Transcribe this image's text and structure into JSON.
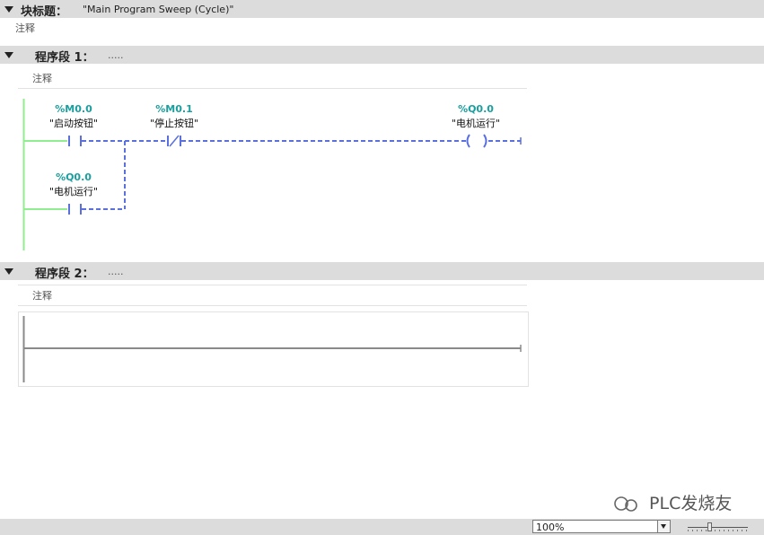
{
  "block": {
    "title_label": "块标题：",
    "title_value": "\"Main Program Sweep (Cycle)\"",
    "comment": "注释"
  },
  "networks": [
    {
      "label": "程序段 1：",
      "dots": ".....",
      "comment": "注释",
      "contacts": [
        {
          "address": "%M0.0",
          "symbol": "\"启动按钮\"",
          "type": "normally-open"
        },
        {
          "address": "%M0.1",
          "symbol": "\"停止按钮\"",
          "type": "normally-closed"
        },
        {
          "address": "%Q0.0",
          "symbol": "\"电机运行\"",
          "type": "coil"
        },
        {
          "address": "%Q0.0",
          "symbol": "\"电机运行\"",
          "type": "normally-open-parallel"
        }
      ]
    },
    {
      "label": "程序段 2：",
      "dots": ".....",
      "comment": "注释"
    }
  ],
  "status": {
    "zoom": "100%"
  },
  "watermark": "PLC发烧友",
  "colors": {
    "address": "#1a9f9f",
    "rung_dashed": "#5a6fe0",
    "power_rail": "#90ee90",
    "header_bar": "#dcdcdc"
  }
}
